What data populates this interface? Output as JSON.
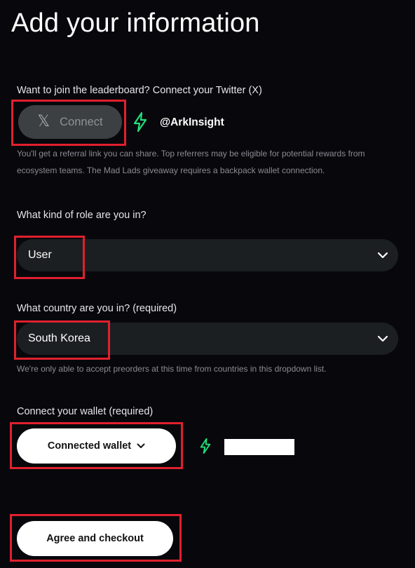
{
  "page": {
    "title": "Add your information"
  },
  "twitter": {
    "label": "Want to join the leaderboard? Connect your Twitter (X)",
    "connect_button": "Connect",
    "handle": "@ArkInsight",
    "help_line1": "You'll get a referral link you can share. Top referrers may be eligible for potential rewards from",
    "help_line2": "ecosystem teams. The Mad Lads giveaway requires a backpack wallet connection."
  },
  "role": {
    "label": "What kind of role are you in?",
    "selected": "User"
  },
  "country": {
    "label": "What country are you in? (required)",
    "selected": "South Korea",
    "help": "We're only able to accept preorders at this time from countries in this dropdown list."
  },
  "wallet": {
    "label": "Connect your wallet (required)",
    "button": "Connected wallet"
  },
  "checkout": {
    "button": "Agree and checkout"
  },
  "colors": {
    "background": "#08080c",
    "accent_green": "#22e07a",
    "highlight_red": "#e0202e",
    "field_bg": "#1c1f22"
  },
  "icons": [
    "x-logo-icon",
    "bolt-icon",
    "chevron-down-icon"
  ]
}
